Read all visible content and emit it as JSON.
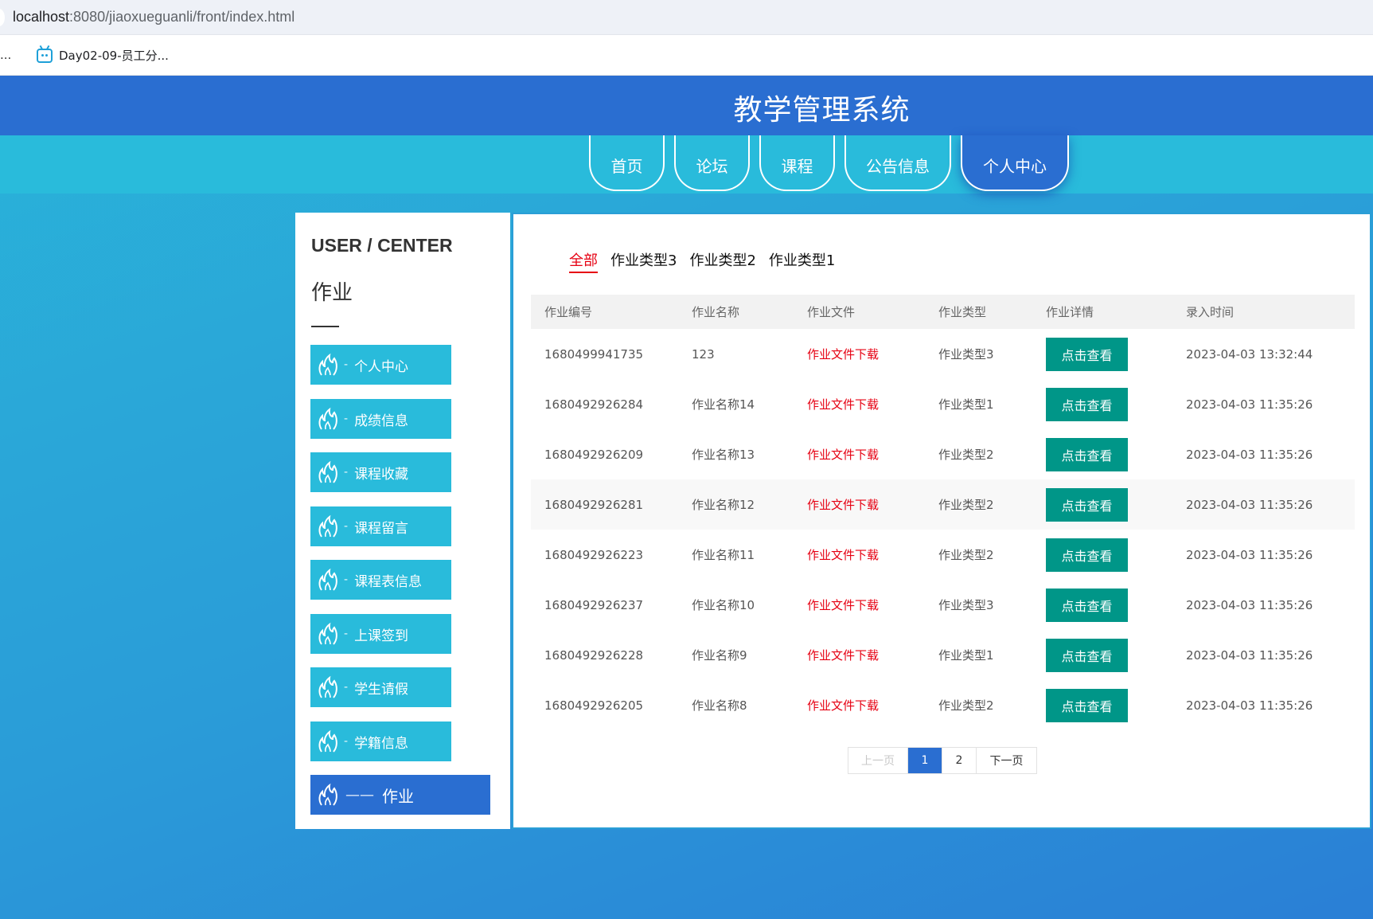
{
  "browser": {
    "url_host": "localhost",
    "url_rest": ":8080/jiaoxueguanli/front/index.html",
    "bookmarks_overflow": "...",
    "bookmark_label": "Day02-09-员工分..."
  },
  "site": {
    "title": "教学管理系统",
    "nav": [
      {
        "label": "首页",
        "active": false
      },
      {
        "label": "论坛",
        "active": false
      },
      {
        "label": "课程",
        "active": false
      },
      {
        "label": "公告信息",
        "active": false
      },
      {
        "label": "个人中心",
        "active": true
      }
    ]
  },
  "sidebar": {
    "heading_en": "USER / CENTER",
    "heading_cn": "作业",
    "dash": "-",
    "active_dash": "——",
    "items": [
      {
        "label": "个人中心"
      },
      {
        "label": "成绩信息"
      },
      {
        "label": "课程收藏"
      },
      {
        "label": "课程留言"
      },
      {
        "label": "课程表信息"
      },
      {
        "label": "上课签到"
      },
      {
        "label": "学生请假"
      },
      {
        "label": "学籍信息"
      },
      {
        "label": "作业",
        "active": true
      }
    ]
  },
  "filters": [
    "全部",
    "作业类型3",
    "作业类型2",
    "作业类型1"
  ],
  "table": {
    "columns": [
      "作业编号",
      "作业名称",
      "作业文件",
      "作业类型",
      "作业详情",
      "录入时间"
    ],
    "rows": [
      {
        "id": "1680499941735",
        "name": "123",
        "file": "作业文件下载",
        "type": "作业类型3",
        "detail": "点击查看",
        "time": "2023-04-03 13:32:44"
      },
      {
        "id": "1680492926284",
        "name": "作业名称14",
        "file": "作业文件下载",
        "type": "作业类型1",
        "detail": "点击查看",
        "time": "2023-04-03 11:35:26"
      },
      {
        "id": "1680492926209",
        "name": "作业名称13",
        "file": "作业文件下载",
        "type": "作业类型2",
        "detail": "点击查看",
        "time": "2023-04-03 11:35:26"
      },
      {
        "id": "1680492926281",
        "name": "作业名称12",
        "file": "作业文件下载",
        "type": "作业类型2",
        "detail": "点击查看",
        "time": "2023-04-03 11:35:26"
      },
      {
        "id": "1680492926223",
        "name": "作业名称11",
        "file": "作业文件下载",
        "type": "作业类型2",
        "detail": "点击查看",
        "time": "2023-04-03 11:35:26"
      },
      {
        "id": "1680492926237",
        "name": "作业名称10",
        "file": "作业文件下载",
        "type": "作业类型3",
        "detail": "点击查看",
        "time": "2023-04-03 11:35:26"
      },
      {
        "id": "1680492926228",
        "name": "作业名称9",
        "file": "作业文件下载",
        "type": "作业类型1",
        "detail": "点击查看",
        "time": "2023-04-03 11:35:26"
      },
      {
        "id": "1680492926205",
        "name": "作业名称8",
        "file": "作业文件下载",
        "type": "作业类型2",
        "detail": "点击查看",
        "time": "2023-04-03 11:35:26"
      }
    ]
  },
  "pagination": {
    "prev": "上一页",
    "pages": [
      "1",
      "2"
    ],
    "current": "1",
    "next": "下一页"
  },
  "colors": {
    "header_blue": "#2a6ed1",
    "accent_cyan": "#29bbdb",
    "view_button": "#009688",
    "link_red": "#e60012"
  }
}
